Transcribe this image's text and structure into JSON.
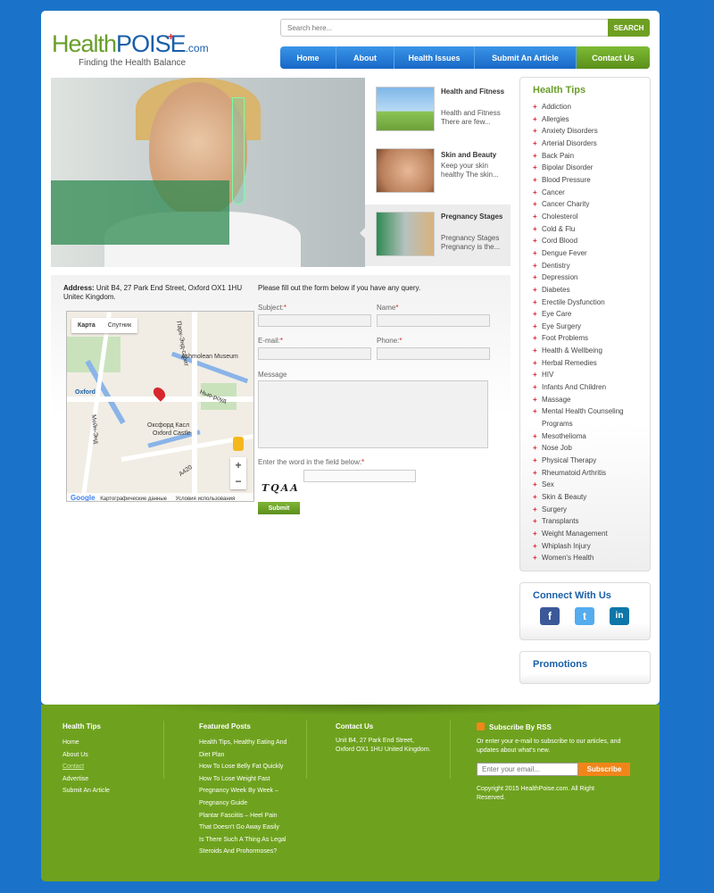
{
  "logo": {
    "health": "Health",
    "p": "P",
    "oise": "OISE",
    "com": ".com",
    "tagline": "Finding the Health Balance"
  },
  "search": {
    "placeholder": "Search here...",
    "button": "SEARCH"
  },
  "nav": [
    "Home",
    "About",
    "Health Issues",
    "Submit An Article",
    "Contact Us"
  ],
  "slider": {
    "thumbs": [
      {
        "title": "Health and Fitness",
        "desc": "Health and Fitness There are few..."
      },
      {
        "title": "Skin and Beauty",
        "desc": "Keep your skin healthy The skin..."
      },
      {
        "title": "Pregnancy Stages",
        "desc": "Pregnancy Stages Pregnancy is the..."
      }
    ]
  },
  "contact": {
    "address_label": "Address:",
    "address": "Unit B4, 27 Park End Street, Oxford OX1 1HU Unitec Kingdom.",
    "map": {
      "tab_map": "Карта",
      "tab_sat": "Спутник",
      "labels": [
        "Ashmolean Museum",
        "Oxford",
        "Оксфорд Касл",
        "Oxford Castle",
        "Нью-роуд",
        "A420",
        "Парк-Энд-стрит",
        "Мейн-Энд"
      ],
      "footer_google": "Google",
      "footer_data": "Картографические данные",
      "footer_terms": "Условия использования"
    },
    "form": {
      "intro": "Please fill out the form below if you have any query.",
      "subject": "Subject:",
      "name": "Name",
      "email": "E-mail:",
      "phone": "Phone:",
      "message": "Message",
      "captcha_label": "Enter the word in the field below:",
      "captcha": "TQAA",
      "submit": "Submit",
      "req": "*"
    }
  },
  "sidebar": {
    "tips_title": "Health Tips",
    "tips": [
      "Addiction",
      "Allergies",
      "Anxiety Disorders",
      "Arterial Disorders",
      "Back Pain",
      "Bipolar Disorder",
      "Blood Pressure",
      "Cancer",
      "Cancer Charity",
      "Cholesterol",
      "Cold & Flu",
      "Cord Blood",
      "Dengue Fever",
      "Dentistry",
      "Depression",
      "Diabetes",
      "Erectile Dysfunction",
      "Eye Care",
      "Eye Surgery",
      "Foot Problems",
      "Health & Wellbeing",
      "Herbal Remedies",
      "HIV",
      "Infants And Children",
      "Massage",
      "Mental Health Counseling Programs",
      "Mesothelioma",
      "Nose Job",
      "Physical Therapy",
      "Rheumatoid Arthritis",
      "Sex",
      "Skin & Beauty",
      "Surgery",
      "Transplants",
      "Weight Management",
      "Whiplash Injury",
      "Women's Health"
    ],
    "connect_title": "Connect With Us",
    "social": [
      "facebook-icon",
      "twitter-icon",
      "linkedin-icon"
    ],
    "promo_title": "Promotions"
  },
  "footer": {
    "col1_title": "Health Tips",
    "col1": [
      "Home",
      "About Us",
      "Contact",
      "Advertise",
      "Submit An Article"
    ],
    "col2_title": "Featured Posts",
    "col2": [
      "Health Tips, Healthy Eating And",
      "Diet Plan",
      "How To Lose Belly Fat Quickly",
      "How To Lose Weight Fast",
      "Pregnancy Week By Week –",
      "Pregnancy Guide",
      "Plantar Fasciitis – Heel Pain",
      "That Doesn't Go Away Easily",
      "Is There Such A Thing As Legal",
      "Steroids And Prohormoses?"
    ],
    "col3_title": "Contact Us",
    "col3": "Unit B4, 27 Park End Street, Oxford OX1 1HU United Kingdom.",
    "col4_title": "Subscribe By RSS",
    "col4_text": "Or enter your e-mail to subscribe to our articles, and updates about what's new.",
    "email_placeholder": "Enter your email...",
    "subscribe": "Subscribe",
    "copyright": "Copyright 2015 HealthPoise.com. All Right Reserved."
  },
  "colors": {
    "brand_green": "#6a9e2a",
    "brand_blue": "#1a5fa8",
    "bg_blue": "#1a73c8",
    "accent_red": "#d8262e",
    "orange": "#f0861a"
  }
}
